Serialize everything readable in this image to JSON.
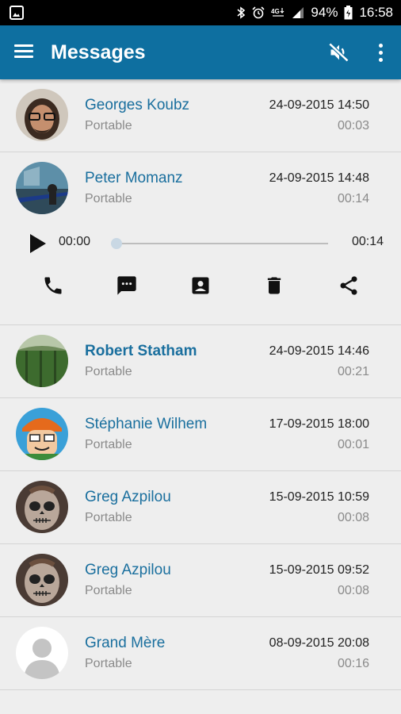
{
  "status_bar": {
    "battery": "94%",
    "time": "16:58",
    "icons": [
      "image-notification-icon",
      "bluetooth-icon",
      "alarm-icon",
      "4g-icon",
      "signal-icon",
      "battery-icon"
    ]
  },
  "app_bar": {
    "title": "Messages",
    "color": "#0e6fa0",
    "icons": [
      "menu-icon",
      "mute-icon",
      "more-vert-icon"
    ]
  },
  "messages": [
    {
      "name": "Georges Koubz",
      "type": "Portable",
      "date": "24-09-2015 14:50",
      "duration": "00:03",
      "bold": false,
      "avatar": "photo-man-glasses"
    },
    {
      "name": "Peter Momanz",
      "type": "Portable",
      "date": "24-09-2015 14:48",
      "duration": "00:14",
      "bold": false,
      "avatar": "photo-landscape",
      "expanded": true
    },
    {
      "name": "Robert Statham",
      "type": "Portable",
      "date": "24-09-2015 14:46",
      "duration": "00:21",
      "bold": true,
      "avatar": "photo-green-field"
    },
    {
      "name": "Stéphanie Wilhem",
      "type": "Portable",
      "date": "17-09-2015 18:00",
      "duration": "00:01",
      "bold": false,
      "avatar": "cartoon-boy"
    },
    {
      "name": "Greg Azpilou",
      "type": "Portable",
      "date": "15-09-2015 10:59",
      "duration": "00:08",
      "bold": false,
      "avatar": "skull-face-paint"
    },
    {
      "name": "Greg Azpilou",
      "type": "Portable",
      "date": "15-09-2015 09:52",
      "duration": "00:08",
      "bold": false,
      "avatar": "skull-face-paint"
    },
    {
      "name": "Grand Mère",
      "type": "Portable",
      "date": "08-09-2015 20:08",
      "duration": "00:16",
      "bold": false,
      "avatar": "default-person"
    }
  ],
  "player": {
    "current": "00:00",
    "total": "00:14",
    "progress": 0,
    "actions": [
      "phone-icon",
      "message-icon",
      "contact-icon",
      "delete-icon",
      "share-icon"
    ]
  }
}
